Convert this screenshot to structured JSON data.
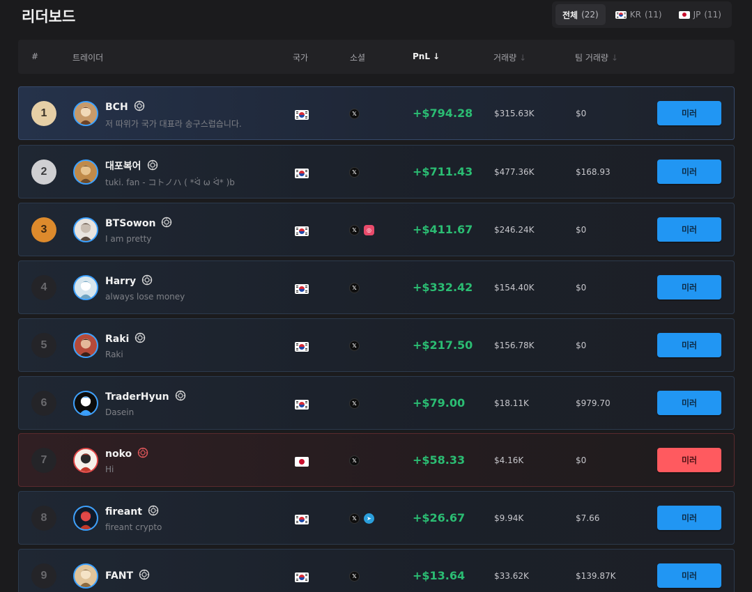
{
  "page": {
    "title": "리더보드"
  },
  "filters": [
    {
      "label": "전체",
      "count": "(22)",
      "flag": "",
      "active": true
    },
    {
      "label": "KR",
      "count": "(11)",
      "flag": "kr",
      "active": false
    },
    {
      "label": "JP",
      "count": "(11)",
      "flag": "jp",
      "active": false
    }
  ],
  "columns": {
    "rank": "#",
    "trader": "트레이더",
    "country": "국가",
    "social": "소셜",
    "pnl": "PnL",
    "volume": "거래량",
    "team_volume": "팀 거래량",
    "sort_arrow": "↓"
  },
  "rows": [
    {
      "rank": "1",
      "name": "BCH",
      "bio": "저 따위가 국가 대표라 송구스럽습니다.",
      "country": "kr",
      "socials": [
        "x"
      ],
      "pnl": "+$794.28",
      "volume": "$315.63K",
      "team_volume": "$0",
      "button": "미러"
    },
    {
      "rank": "2",
      "name": "대포복어",
      "bio": "tuki. fan - コトノハ ( *ᐛ ω ᐛ* )b",
      "country": "kr",
      "socials": [
        "x"
      ],
      "pnl": "+$711.43",
      "volume": "$477.36K",
      "team_volume": "$168.93",
      "button": "미러"
    },
    {
      "rank": "3",
      "name": "BTSowon",
      "bio": "I am pretty",
      "country": "kr",
      "socials": [
        "x",
        "instagram"
      ],
      "pnl": "+$411.67",
      "volume": "$246.24K",
      "team_volume": "$0",
      "button": "미러"
    },
    {
      "rank": "4",
      "name": "Harry",
      "bio": "always lose money",
      "country": "kr",
      "socials": [
        "x"
      ],
      "pnl": "+$332.42",
      "volume": "$154.40K",
      "team_volume": "$0",
      "button": "미러"
    },
    {
      "rank": "5",
      "name": "Raki",
      "bio": "Raki",
      "country": "kr",
      "socials": [
        "x"
      ],
      "pnl": "+$217.50",
      "volume": "$156.78K",
      "team_volume": "$0",
      "button": "미러"
    },
    {
      "rank": "6",
      "name": "TraderHyun",
      "bio": "Dasein",
      "country": "kr",
      "socials": [
        "x"
      ],
      "pnl": "+$79.00",
      "volume": "$18.11K",
      "team_volume": "$979.70",
      "button": "미러"
    },
    {
      "rank": "7",
      "name": "noko",
      "bio": "Hi",
      "country": "jp",
      "socials": [
        "x"
      ],
      "pnl": "+$58.33",
      "volume": "$4.16K",
      "team_volume": "$0",
      "button": "미러"
    },
    {
      "rank": "8",
      "name": "fireant",
      "bio": "fireant crypto",
      "country": "kr",
      "socials": [
        "x",
        "telegram"
      ],
      "pnl": "+$26.67",
      "volume": "$9.94K",
      "team_volume": "$7.66",
      "button": "미러"
    },
    {
      "rank": "9",
      "name": "FANT",
      "bio": "",
      "country": "kr",
      "socials": [
        "x"
      ],
      "pnl": "+$13.64",
      "volume": "$33.62K",
      "team_volume": "$139.87K",
      "button": "미러"
    }
  ],
  "colors": {
    "kr_button": "#2196f3",
    "jp_button": "#ff5a5f",
    "pnl_positive": "#2bbd73"
  }
}
